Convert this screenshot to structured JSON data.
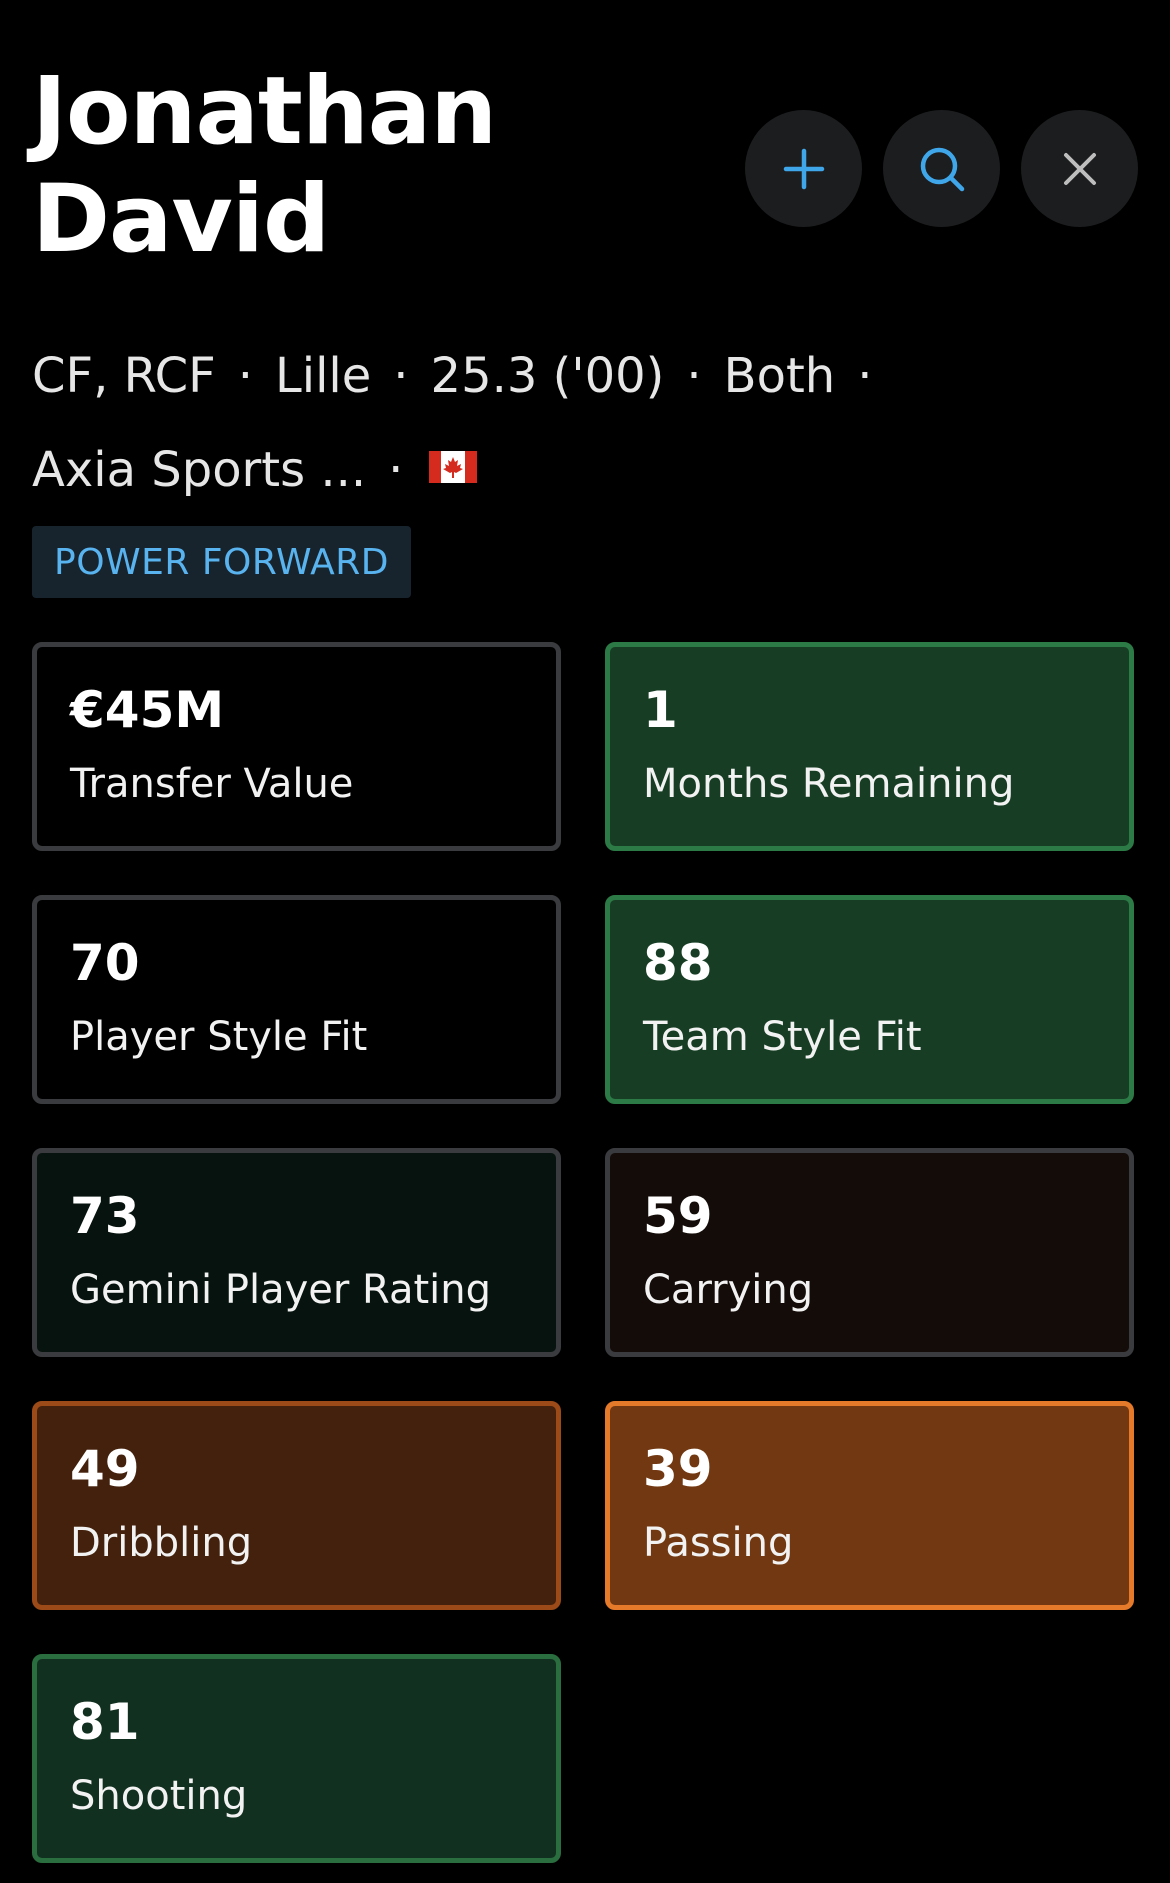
{
  "player": {
    "name_line1": "Jonathan",
    "name_line2": "David"
  },
  "actions": {
    "add_icon": "plus-icon",
    "search_icon": "search-icon",
    "close_icon": "close-icon",
    "accent_color": "#3fa6ea"
  },
  "meta": {
    "positions": "CF, RCF",
    "club": "Lille",
    "age": "25.3 ('00)",
    "foot": "Both",
    "agency": "Axia Sports ...",
    "nationality_flag": "canada-flag",
    "separator": "·"
  },
  "role_badge": "POWER FORWARD",
  "stats": [
    {
      "value": "€45M",
      "label": "Transfer Value"
    },
    {
      "value": "1",
      "label": "Months Remaining"
    },
    {
      "value": "70",
      "label": "Player Style Fit"
    },
    {
      "value": "88",
      "label": "Team Style Fit"
    },
    {
      "value": "73",
      "label": "Gemini Player Rating"
    },
    {
      "value": "59",
      "label": "Carrying"
    },
    {
      "value": "49",
      "label": "Dribbling"
    },
    {
      "value": "39",
      "label": "Passing"
    },
    {
      "value": "81",
      "label": "Shooting"
    }
  ],
  "colors": {
    "green_card": "#173e24",
    "orange_card": "#713811",
    "badge_text": "#58b3ef"
  }
}
